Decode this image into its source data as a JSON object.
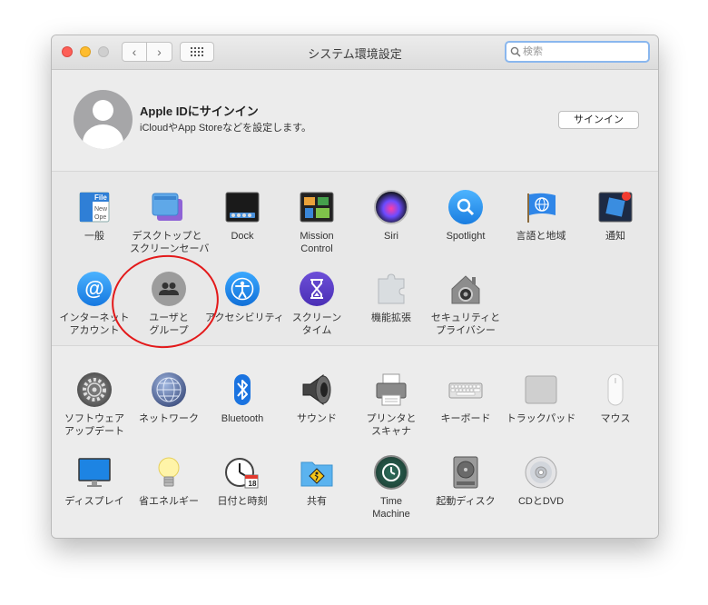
{
  "window": {
    "title": "システム環境設定",
    "search_placeholder": "検索"
  },
  "apple_id": {
    "title": "Apple IDにサインイン",
    "subtitle": "iCloudやApp Storeなどを設定します。",
    "signin_label": "サインイン"
  },
  "row1": [
    {
      "label": "一般",
      "icon": "general-icon"
    },
    {
      "label": "デスクトップと\nスクリーンセーバ",
      "icon": "desktop-icon"
    },
    {
      "label": "Dock",
      "icon": "dock-icon"
    },
    {
      "label": "Mission\nControl",
      "icon": "mission-control-icon"
    },
    {
      "label": "Siri",
      "icon": "siri-icon"
    },
    {
      "label": "Spotlight",
      "icon": "spotlight-icon"
    },
    {
      "label": "言語と地域",
      "icon": "language-region-icon"
    },
    {
      "label": "通知",
      "icon": "notifications-icon"
    }
  ],
  "row2": [
    {
      "label": "インターネット\nアカウント",
      "icon": "internet-accounts-icon"
    },
    {
      "label": "ユーザと\nグループ",
      "icon": "users-groups-icon"
    },
    {
      "label": "アクセシビリティ",
      "icon": "accessibility-icon"
    },
    {
      "label": "スクリーン\nタイム",
      "icon": "screen-time-icon"
    },
    {
      "label": "機能拡張",
      "icon": "extensions-icon"
    },
    {
      "label": "セキュリティと\nプライバシー",
      "icon": "security-privacy-icon"
    }
  ],
  "row3": [
    {
      "label": "ソフトウェア\nアップデート",
      "icon": "software-update-icon"
    },
    {
      "label": "ネットワーク",
      "icon": "network-icon"
    },
    {
      "label": "Bluetooth",
      "icon": "bluetooth-icon"
    },
    {
      "label": "サウンド",
      "icon": "sound-icon"
    },
    {
      "label": "プリンタと\nスキャナ",
      "icon": "printers-scanners-icon"
    },
    {
      "label": "キーボード",
      "icon": "keyboard-icon"
    },
    {
      "label": "トラックパッド",
      "icon": "trackpad-icon"
    },
    {
      "label": "マウス",
      "icon": "mouse-icon"
    }
  ],
  "row4": [
    {
      "label": "ディスプレイ",
      "icon": "displays-icon"
    },
    {
      "label": "省エネルギー",
      "icon": "energy-saver-icon"
    },
    {
      "label": "日付と時刻",
      "icon": "date-time-icon",
      "day": "18"
    },
    {
      "label": "共有",
      "icon": "sharing-icon"
    },
    {
      "label": "Time\nMachine",
      "icon": "time-machine-icon"
    },
    {
      "label": "起動ディスク",
      "icon": "startup-disk-icon"
    },
    {
      "label": "CDとDVD",
      "icon": "cd-dvd-icon"
    }
  ],
  "colors": {
    "annotation": "#e3191a",
    "search_focus": "#8ab7ee"
  }
}
